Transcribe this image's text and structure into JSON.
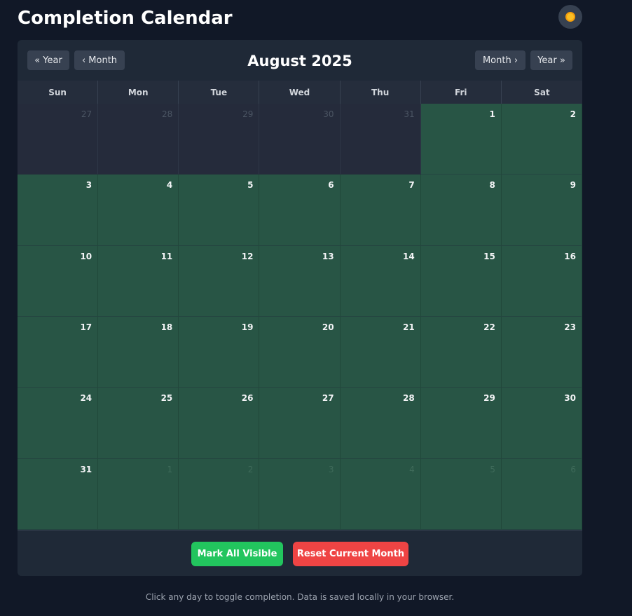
{
  "page": {
    "title": "Completion Calendar",
    "theme_icon": "sun-icon"
  },
  "nav": {
    "prev_year": "« Year",
    "prev_month": "‹ Month",
    "next_month": "Month ›",
    "next_year": "Year »",
    "current": "August 2025"
  },
  "weekdays": [
    "Sun",
    "Mon",
    "Tue",
    "Wed",
    "Thu",
    "Fri",
    "Sat"
  ],
  "days": [
    {
      "n": "27",
      "current_month": false,
      "completed": false
    },
    {
      "n": "28",
      "current_month": false,
      "completed": false
    },
    {
      "n": "29",
      "current_month": false,
      "completed": false
    },
    {
      "n": "30",
      "current_month": false,
      "completed": false
    },
    {
      "n": "31",
      "current_month": false,
      "completed": false
    },
    {
      "n": "1",
      "current_month": true,
      "completed": true
    },
    {
      "n": "2",
      "current_month": true,
      "completed": true
    },
    {
      "n": "3",
      "current_month": true,
      "completed": true
    },
    {
      "n": "4",
      "current_month": true,
      "completed": true
    },
    {
      "n": "5",
      "current_month": true,
      "completed": true
    },
    {
      "n": "6",
      "current_month": true,
      "completed": true
    },
    {
      "n": "7",
      "current_month": true,
      "completed": true
    },
    {
      "n": "8",
      "current_month": true,
      "completed": true
    },
    {
      "n": "9",
      "current_month": true,
      "completed": true
    },
    {
      "n": "10",
      "current_month": true,
      "completed": true
    },
    {
      "n": "11",
      "current_month": true,
      "completed": true
    },
    {
      "n": "12",
      "current_month": true,
      "completed": true
    },
    {
      "n": "13",
      "current_month": true,
      "completed": true
    },
    {
      "n": "14",
      "current_month": true,
      "completed": true
    },
    {
      "n": "15",
      "current_month": true,
      "completed": true
    },
    {
      "n": "16",
      "current_month": true,
      "completed": true
    },
    {
      "n": "17",
      "current_month": true,
      "completed": true
    },
    {
      "n": "18",
      "current_month": true,
      "completed": true
    },
    {
      "n": "19",
      "current_month": true,
      "completed": true
    },
    {
      "n": "20",
      "current_month": true,
      "completed": true
    },
    {
      "n": "21",
      "current_month": true,
      "completed": true
    },
    {
      "n": "22",
      "current_month": true,
      "completed": true
    },
    {
      "n": "23",
      "current_month": true,
      "completed": true
    },
    {
      "n": "24",
      "current_month": true,
      "completed": true
    },
    {
      "n": "25",
      "current_month": true,
      "completed": true
    },
    {
      "n": "26",
      "current_month": true,
      "completed": true
    },
    {
      "n": "27",
      "current_month": true,
      "completed": true
    },
    {
      "n": "28",
      "current_month": true,
      "completed": true
    },
    {
      "n": "29",
      "current_month": true,
      "completed": true
    },
    {
      "n": "30",
      "current_month": true,
      "completed": true
    },
    {
      "n": "31",
      "current_month": true,
      "completed": true
    },
    {
      "n": "1",
      "current_month": false,
      "completed": true
    },
    {
      "n": "2",
      "current_month": false,
      "completed": true
    },
    {
      "n": "3",
      "current_month": false,
      "completed": true
    },
    {
      "n": "4",
      "current_month": false,
      "completed": true
    },
    {
      "n": "5",
      "current_month": false,
      "completed": true
    },
    {
      "n": "6",
      "current_month": false,
      "completed": true
    }
  ],
  "actions": {
    "mark_all": "Mark All Visible",
    "reset": "Reset Current Month"
  },
  "footer": {
    "note": "Click any day to toggle completion. Data is saved locally in your browser."
  },
  "colors": {
    "background": "#111827",
    "card": "#1f2937",
    "completed_day": "#285545",
    "mark_all": "#22c55e",
    "reset": "#ef4444"
  }
}
